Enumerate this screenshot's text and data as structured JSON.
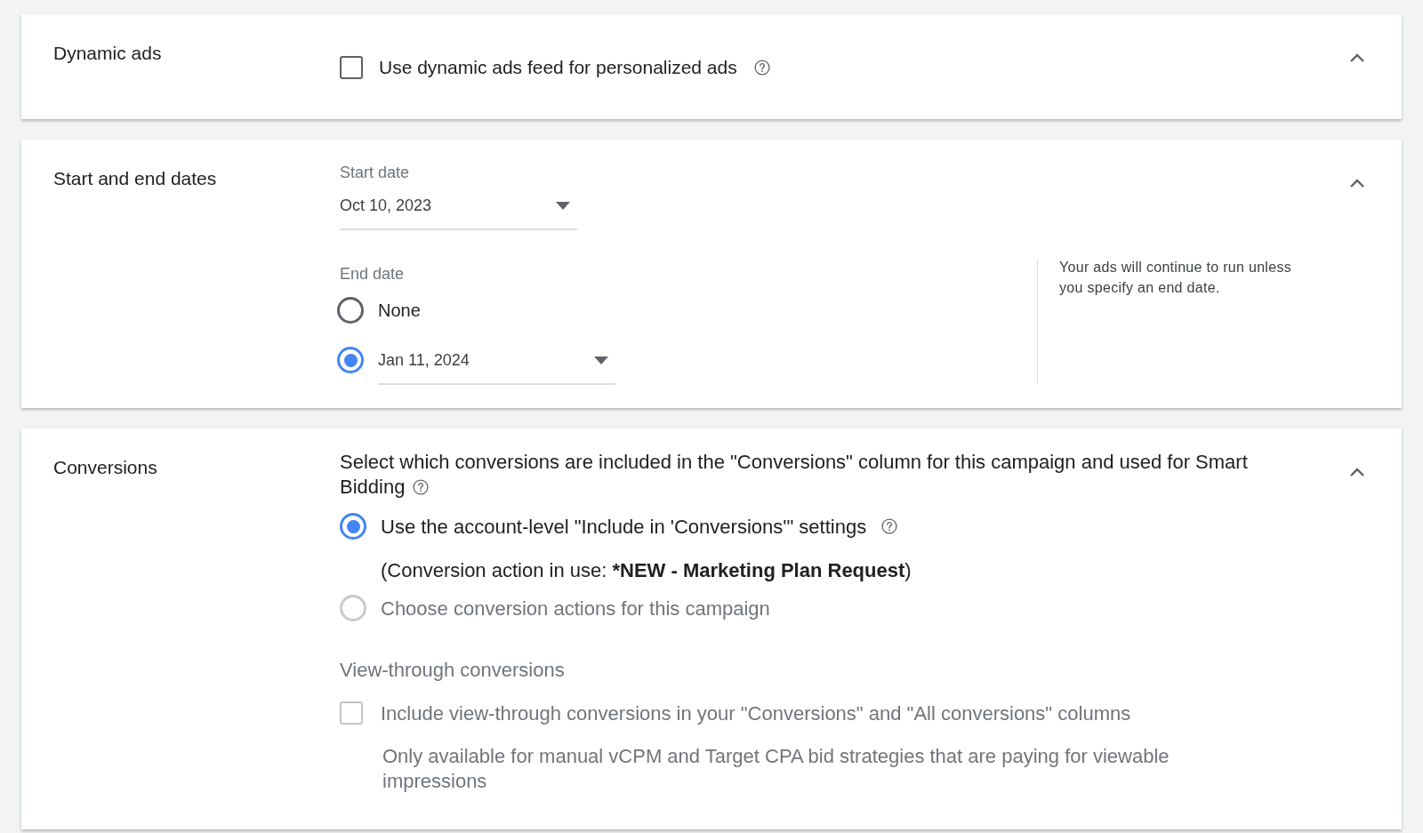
{
  "sections": [
    {
      "kind": "dynamic",
      "title": "Dynamic ads",
      "expanded": true,
      "checkbox": {
        "label": "Use dynamic ads feed for personalized ads",
        "checked": false,
        "disabled": false,
        "help": true
      }
    },
    {
      "kind": "dates",
      "title": "Start and end dates",
      "expanded": true,
      "start_date": {
        "label": "Start date",
        "value": "Oct 10, 2023"
      },
      "end_date": {
        "label": "End date",
        "options": [
          {
            "kind": "text",
            "label": "None",
            "selected": false
          },
          {
            "kind": "date",
            "value": "Jan 11, 2024",
            "selected": true
          }
        ]
      },
      "note": "Your ads will continue to run unless you specify an end date."
    },
    {
      "kind": "conversions",
      "title": "Conversions",
      "expanded": true,
      "description": "Select which conversions are included in the \"Conversions\" column for this campaign and used for Smart Bidding",
      "description_help": true,
      "options": [
        {
          "label": "Use the account-level \"Include in 'Conversions'\" settings",
          "selected": true,
          "disabled": false,
          "help": true,
          "detail": {
            "text": "(Conversion action in use: ",
            "bold": "*NEW - Marketing Plan Request",
            "end": ")"
          }
        },
        {
          "label": "Choose conversion actions for this campaign",
          "selected": false,
          "disabled": true,
          "help": false
        }
      ],
      "view_through": {
        "heading": "View-through conversions",
        "checkbox": {
          "label": "Include view-through conversions in your \"Conversions\" and \"All conversions\" columns",
          "checked": false,
          "disabled": true
        },
        "note": "Only available for manual vCPM and Target CPA bid strategies that are paying for viewable impressions"
      }
    }
  ]
}
